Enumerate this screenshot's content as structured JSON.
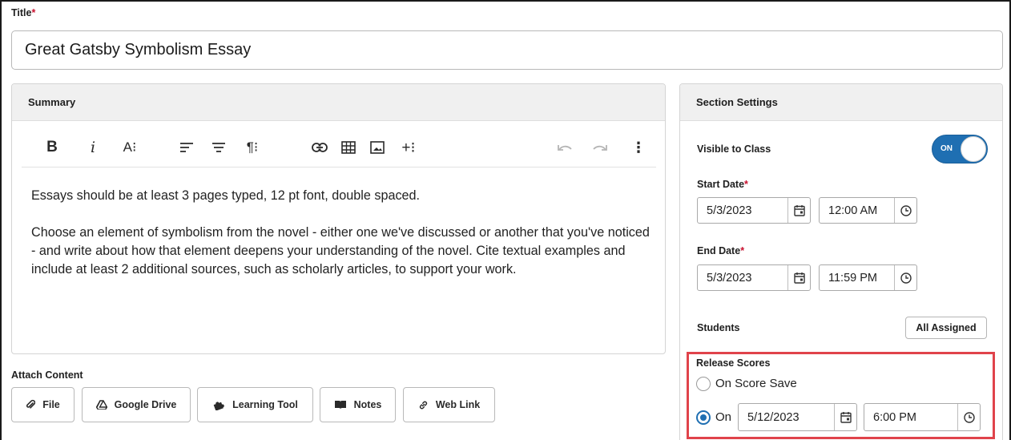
{
  "title": {
    "label": "Title",
    "required_mark": "*",
    "value": "Great Gatsby Symbolism Essay"
  },
  "summary": {
    "header": "Summary",
    "toolbar": [
      {
        "name": "bold",
        "glyph": "B"
      },
      {
        "name": "italic",
        "glyph": "i"
      },
      {
        "name": "font-size",
        "glyph": "A⁝"
      },
      {
        "name": "align",
        "icon": "align-left-icon"
      },
      {
        "name": "list",
        "icon": "align-center-icon"
      },
      {
        "name": "paragraph",
        "glyph": "¶⁝"
      },
      {
        "name": "link",
        "icon": "link-icon"
      },
      {
        "name": "table",
        "icon": "table-icon"
      },
      {
        "name": "image",
        "icon": "image-icon"
      },
      {
        "name": "insert",
        "glyph": "+⁝"
      },
      {
        "name": "undo",
        "icon": "undo-icon"
      },
      {
        "name": "redo",
        "icon": "redo-icon"
      },
      {
        "name": "more",
        "glyph": "⋮"
      }
    ],
    "paragraphs": [
      "Essays should be at least 3 pages typed, 12 pt font, double spaced.",
      "Choose an element of symbolism from the novel - either one we've discussed or another that you've noticed - and write about how that element deepens your understanding of the novel. Cite textual examples and include at least 2 additional sources, such as scholarly articles, to support your work."
    ]
  },
  "attach": {
    "label": "Attach Content",
    "buttons": [
      {
        "label": "File",
        "icon": "paperclip-icon"
      },
      {
        "label": "Google Drive",
        "icon": "google-drive-icon"
      },
      {
        "label": "Learning Tool",
        "icon": "puzzle-icon"
      },
      {
        "label": "Notes",
        "icon": "book-icon"
      },
      {
        "label": "Web Link",
        "icon": "link-icon"
      }
    ]
  },
  "settings": {
    "header": "Section Settings",
    "visible_label": "Visible to Class",
    "visible_toggle": "ON",
    "start_date_label": "Start Date",
    "start_date": "5/3/2023",
    "start_time": "12:00 AM",
    "end_date_label": "End Date",
    "end_date": "5/3/2023",
    "end_time": "11:59 PM",
    "required_mark": "*",
    "students_label": "Students",
    "students_button": "All Assigned",
    "release_label": "Release Scores",
    "release_option_save": "On Score Save",
    "release_option_on": "On",
    "release_date": "5/12/2023",
    "release_time": "6:00 PM",
    "release_selected": "On"
  },
  "colors": {
    "accent": "#1f6fb2",
    "required": "#c8102e",
    "highlight": "#e0434b"
  }
}
